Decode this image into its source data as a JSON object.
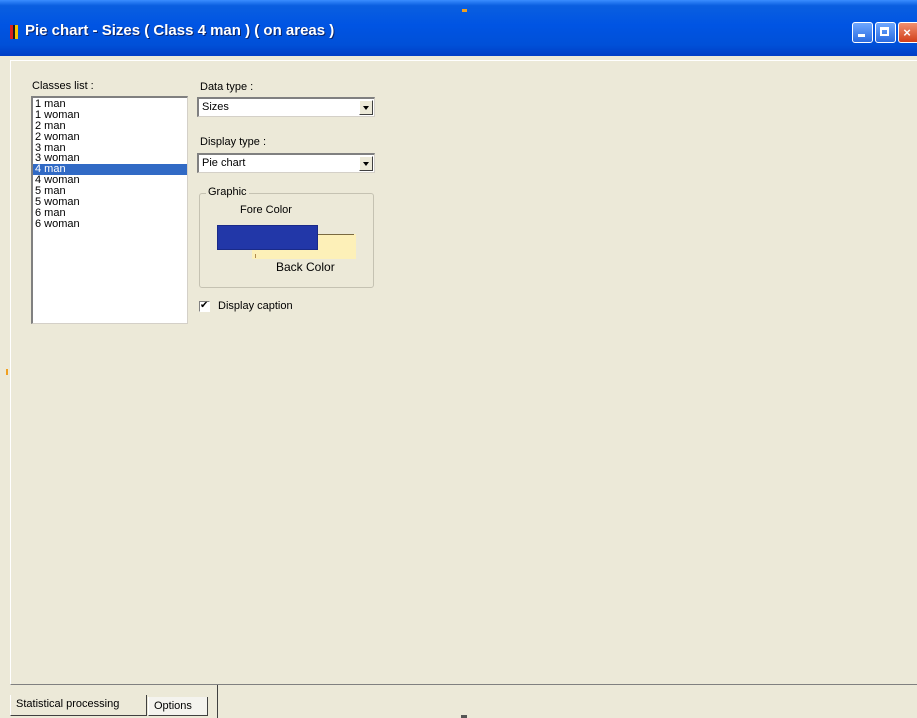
{
  "window": {
    "title": "Pie chart - Sizes ( Class 4 man ) ( on areas )",
    "icon_colors": [
      "#d61f1f",
      "#1a1a1a",
      "#f5c400"
    ]
  },
  "classes": {
    "label": "Classes list :",
    "items": [
      "1 man",
      "1 woman",
      "2 man",
      "2 woman",
      "3 man",
      "3 woman",
      "4 man",
      "4 woman",
      "5 man",
      "5 woman",
      "6 man",
      "6 woman"
    ],
    "selected": "4 man"
  },
  "data_type": {
    "label": "Data type :",
    "value": "Sizes"
  },
  "display_type": {
    "label": "Display type :",
    "value": "Pie chart"
  },
  "graphic": {
    "title": "Graphic",
    "fore_label": "Fore Color",
    "back_label": "Back Color",
    "fore_color": "#2237a8",
    "back_color": "#fdf0b8"
  },
  "display_caption": {
    "label": "Display caption",
    "checked": true
  },
  "tabs": [
    {
      "label": "Statistical processing",
      "active": true
    },
    {
      "label": "Options",
      "active": false
    }
  ]
}
